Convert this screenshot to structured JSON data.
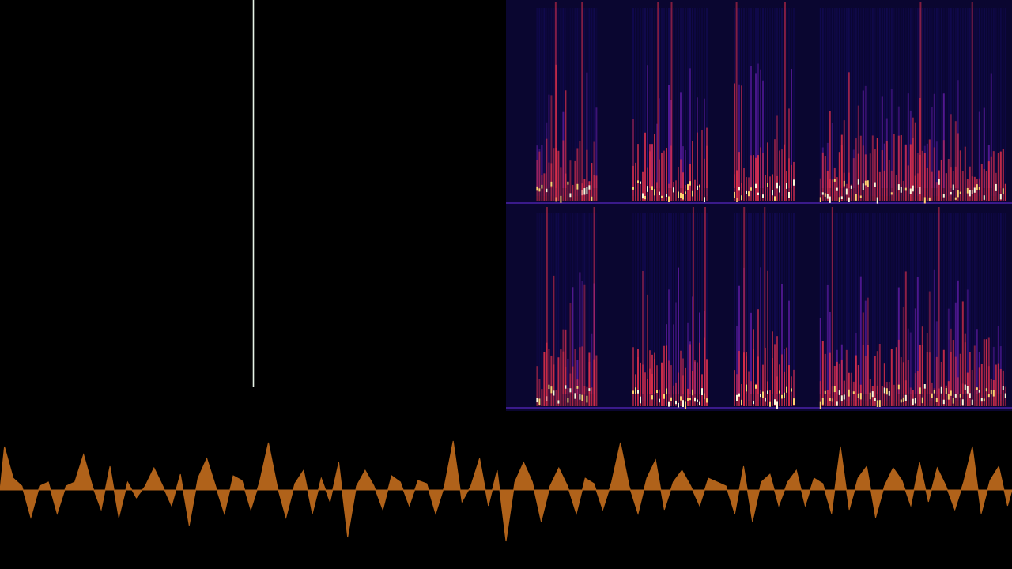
{
  "colors": {
    "background": "#000000",
    "cursor_line": "#e6f3e6",
    "spectrogram_base": "#0a0630",
    "spectrogram_dark": "#120a55",
    "spectrogram_mid": "#6a1fb0",
    "spectrogram_hot": "#e0304a",
    "spectrogram_peak": "#ffd070",
    "spectrogram_white": "#fff6d8",
    "waveform_fill": "#b0621a"
  },
  "spectrogram": {
    "channels": 2,
    "segments": [
      {
        "start": 0.06,
        "end": 0.18,
        "energy": 0.9
      },
      {
        "start": 0.25,
        "end": 0.4,
        "energy": 1.0
      },
      {
        "start": 0.45,
        "end": 0.57,
        "energy": 0.85
      },
      {
        "start": 0.62,
        "end": 0.99,
        "energy": 0.95
      }
    ]
  },
  "waveform": {
    "peaks": [
      0.55,
      0.15,
      0.05,
      -0.35,
      0.05,
      0.1,
      -0.3,
      0.05,
      0.1,
      0.45,
      0.05,
      -0.25,
      0.3,
      -0.35,
      0.1,
      -0.1,
      0.05,
      0.28,
      0.05,
      -0.2,
      0.2,
      -0.45,
      0.15,
      0.4,
      0.05,
      -0.3,
      0.18,
      0.12,
      -0.25,
      0.1,
      0.6,
      0.05,
      -0.35,
      0.08,
      0.25,
      -0.3,
      0.15,
      -0.15,
      0.35,
      -0.6,
      0.05,
      0.25,
      0.05,
      -0.25,
      0.18,
      0.1,
      -0.2,
      0.12,
      0.08,
      -0.3,
      0.05,
      0.62,
      -0.15,
      0.05,
      0.4,
      -0.2,
      0.25,
      -0.65,
      0.1,
      0.35,
      0.1,
      -0.4,
      0.05,
      0.28,
      0.05,
      -0.3,
      0.15,
      0.08,
      -0.25,
      0.1,
      0.6,
      0.05,
      -0.3,
      0.15,
      0.38,
      -0.25,
      0.1,
      0.25,
      0.05,
      -0.2,
      0.15,
      0.1,
      0.05,
      -0.3,
      0.3,
      -0.4,
      0.1,
      0.2,
      -0.2,
      0.1,
      0.25,
      -0.2,
      0.15,
      0.08,
      -0.3,
      0.55,
      -0.25,
      0.15,
      0.3,
      -0.35,
      0.05,
      0.28,
      0.12,
      -0.2,
      0.35,
      -0.15,
      0.28,
      0.05,
      -0.25,
      0.1,
      0.55,
      -0.3,
      0.12,
      0.3,
      -0.2
    ]
  }
}
